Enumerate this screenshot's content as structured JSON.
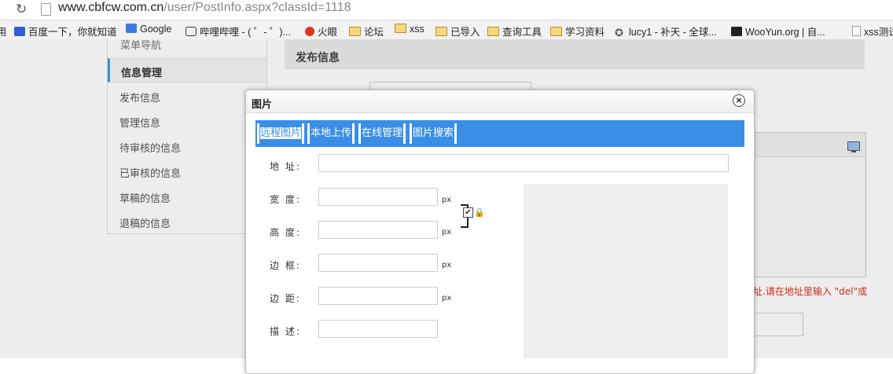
{
  "browser": {
    "url_domain": "www.cbfcw.com.cn",
    "url_path": "/user/PostInfo.aspx?classId=1118",
    "bookmarks": [
      {
        "label": "百度一下，你就知道",
        "icon": "baidu-paw-icon"
      },
      {
        "label": "Google",
        "icon": "google-icon"
      },
      {
        "label": "哔哩哔哩 - ( ゜- ゜)...",
        "icon": "bilibili-tv-icon"
      },
      {
        "label": "火眼",
        "icon": "fire-eye-icon"
      },
      {
        "label": "论坛",
        "icon": "folder-icon"
      },
      {
        "label": "xss",
        "icon": "folder-icon"
      },
      {
        "label": "已导入",
        "icon": "folder-icon"
      },
      {
        "label": "查询工具",
        "icon": "folder-icon"
      },
      {
        "label": "学习资料",
        "icon": "folder-icon"
      },
      {
        "label": "lucy1 - 补天 - 全球...",
        "icon": "star-gear-icon"
      },
      {
        "label": "WooYun.org | 自...",
        "icon": "wooyun-icon"
      },
      {
        "label": "xss测试",
        "icon": "page-icon"
      }
    ],
    "partial_left_label": "用"
  },
  "sidebar": {
    "header": "菜单导航",
    "active_item": "信息管理",
    "items": [
      "发布信息",
      "管理信息",
      "待审核的信息",
      "已审核的信息",
      "草稿的信息",
      "退稿的信息"
    ]
  },
  "main": {
    "title": "发布信息",
    "warning": "址.请在地址里输入 \"del\"或"
  },
  "dialog": {
    "title": "图片",
    "close_glyph": "×",
    "tabs": [
      "远程图片",
      "本地上传",
      "在线管理",
      "图片搜索"
    ],
    "fields": {
      "address_label": "地 址:",
      "width_label": "宽 度:",
      "height_label": "高 度:",
      "border_label": "边 框:",
      "margin_label": "边 距:",
      "desc_label": "描 述:",
      "unit": "px",
      "address_value": "",
      "width_value": "",
      "height_value": "",
      "border_value": "",
      "margin_value": "",
      "desc_value": ""
    },
    "lock_ratio_checked": true
  }
}
